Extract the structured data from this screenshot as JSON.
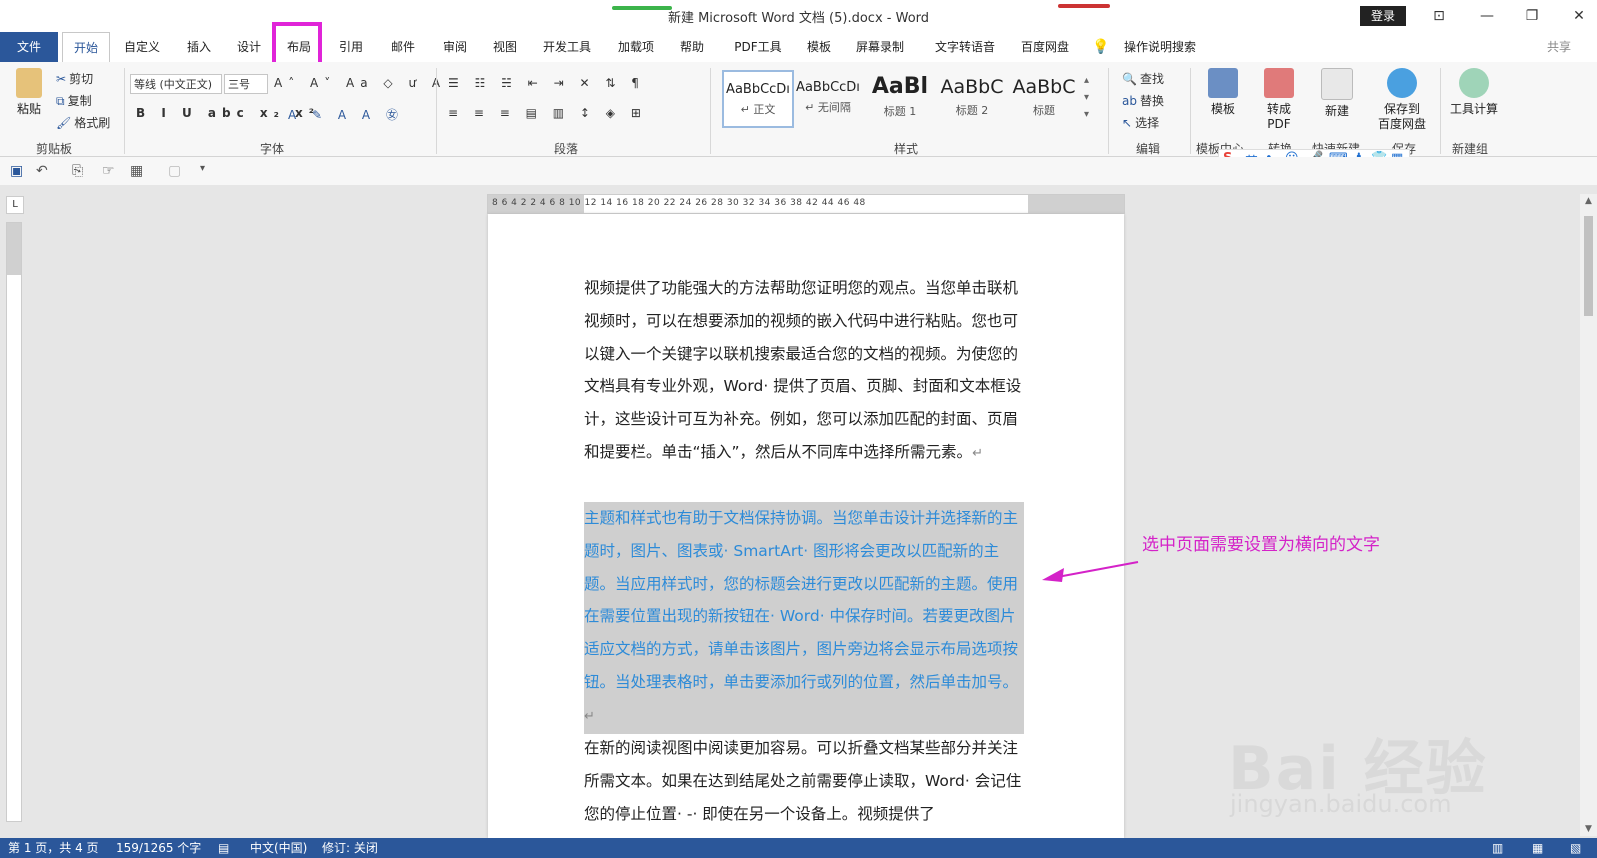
{
  "window": {
    "title": "新建 Microsoft Word 文档 (5).docx  -  Word",
    "login": "登录",
    "controls": [
      "⊡",
      "—",
      "❐",
      "✕"
    ]
  },
  "menu": {
    "tabs": [
      "文件",
      "开始",
      "自定义",
      "插入",
      "设计",
      "布局",
      "引用",
      "邮件",
      "审阅",
      "视图",
      "开发工具",
      "加载项",
      "帮助",
      "PDF工具",
      "模板",
      "屏幕录制",
      "文字转语音",
      "百度网盘"
    ],
    "search": "操作说明搜索",
    "share": "共享"
  },
  "ribbon": {
    "clipboard": {
      "paste": "粘贴",
      "cut": "剪切",
      "copy": "复制",
      "format_painter": "格式刷",
      "label": "剪贴板"
    },
    "font": {
      "name": "等线 (中文正文)",
      "size": "三号",
      "label": "字体"
    },
    "paragraph": {
      "label": "段落"
    },
    "styles": {
      "items": [
        {
          "preview": "AaBbCcDı",
          "name": "↵ 正文"
        },
        {
          "preview": "AaBbCcDı",
          "name": "↵ 无间隔"
        },
        {
          "preview": "AaBl",
          "name": "标题 1"
        },
        {
          "preview": "AaBbC",
          "name": "标题 2"
        },
        {
          "preview": "AaBbC",
          "name": "标题"
        }
      ],
      "label": "样式"
    },
    "edit": {
      "find": "查找",
      "replace": "替换",
      "select": "选择",
      "label": "编辑"
    },
    "template": {
      "btn": "模板",
      "label": "模板中心"
    },
    "convert": {
      "btn1": "转成",
      "btn2": "PDF",
      "label": "转换"
    },
    "quick": {
      "btn": "新建",
      "label": "快速新建"
    },
    "save": {
      "btn1": "保存到",
      "btn2": "百度网盘",
      "label": "保存"
    },
    "newgroup": {
      "btn": "工具计算",
      "label": "新建组"
    }
  },
  "sogou": {
    "lang": "英"
  },
  "ruler": {
    "numbers": "8  6  4  2    2  4  6  8  10  12  14  16  18  20  22  24  26  28  30  32  34  36  38     42  44  46  48",
    "corner": "L"
  },
  "document": {
    "para1": "视频提供了功能强大的方法帮助您证明您的观点。当您单击联机视频时，可以在想要添加的视频的嵌入代码中进行粘贴。您也可以键入一个关键字以联机搜索最适合您的文档的视频。为使您的文档具有专业外观，Word· 提供了页眉、页脚、封面和文本框设计，这些设计可互为补充。例如，您可以添加匹配的封面、页眉和提要栏。单击“插入”，然后从不同库中选择所需元素。",
    "para2": "主题和样式也有助于文档保持协调。当您单击设计并选择新的主题时，图片、图表或· SmartArt· 图形将会更改以匹配新的主题。当应用样式时，您的标题会进行更改以匹配新的主题。使用在需要位置出现的新按钮在· Word· 中保存时间。若要更改图片适应文档的方式，请单击该图片，图片旁边将会显示布局选项按钮。当处理表格时，单击要添加行或列的位置，然后单击加号。",
    "para3": "在新的阅读视图中阅读更加容易。可以折叠文档某些部分并关注所需文本。如果在达到结尾处之前需要停止读取，Word· 会记住您的停止位置· -· 即使在另一个设备上。视频提供了",
    "para_mark": "↵"
  },
  "annotation": {
    "text": "选中页面需要设置为横向的文字",
    "color": "#d422c8"
  },
  "statusbar": {
    "page": "第 1 页，共 4 页",
    "words": "159/1265 个字",
    "lang": "中文(中国)",
    "track": "修订: 关闭"
  },
  "watermark": {
    "main": "Bai 经验",
    "sub": "jingyan.baidu.com"
  },
  "colors": {
    "accent": "#2b579a",
    "highlight": "#e024d8",
    "selection_text": "#2d8bd8"
  }
}
